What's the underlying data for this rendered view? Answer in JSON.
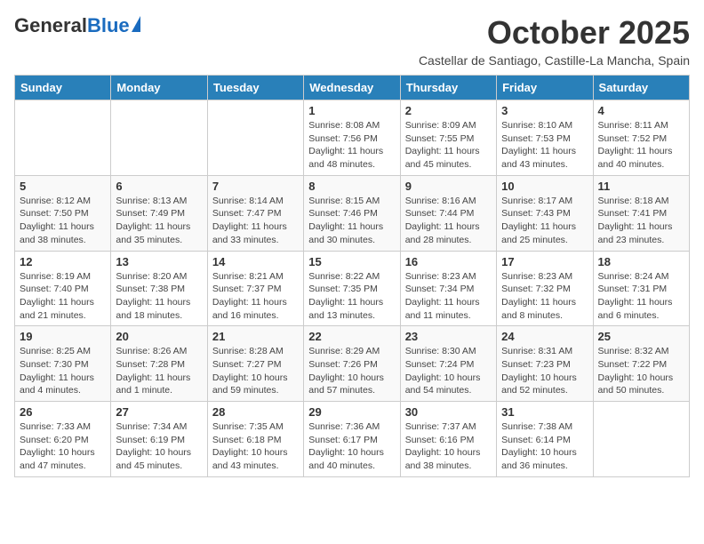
{
  "header": {
    "logo_general": "General",
    "logo_blue": "Blue",
    "month_title": "October 2025",
    "subtitle": "Castellar de Santiago, Castille-La Mancha, Spain"
  },
  "days_of_week": [
    "Sunday",
    "Monday",
    "Tuesday",
    "Wednesday",
    "Thursday",
    "Friday",
    "Saturday"
  ],
  "weeks": [
    [
      {
        "day": "",
        "info": ""
      },
      {
        "day": "",
        "info": ""
      },
      {
        "day": "",
        "info": ""
      },
      {
        "day": "1",
        "info": "Sunrise: 8:08 AM\nSunset: 7:56 PM\nDaylight: 11 hours and 48 minutes."
      },
      {
        "day": "2",
        "info": "Sunrise: 8:09 AM\nSunset: 7:55 PM\nDaylight: 11 hours and 45 minutes."
      },
      {
        "day": "3",
        "info": "Sunrise: 8:10 AM\nSunset: 7:53 PM\nDaylight: 11 hours and 43 minutes."
      },
      {
        "day": "4",
        "info": "Sunrise: 8:11 AM\nSunset: 7:52 PM\nDaylight: 11 hours and 40 minutes."
      }
    ],
    [
      {
        "day": "5",
        "info": "Sunrise: 8:12 AM\nSunset: 7:50 PM\nDaylight: 11 hours and 38 minutes."
      },
      {
        "day": "6",
        "info": "Sunrise: 8:13 AM\nSunset: 7:49 PM\nDaylight: 11 hours and 35 minutes."
      },
      {
        "day": "7",
        "info": "Sunrise: 8:14 AM\nSunset: 7:47 PM\nDaylight: 11 hours and 33 minutes."
      },
      {
        "day": "8",
        "info": "Sunrise: 8:15 AM\nSunset: 7:46 PM\nDaylight: 11 hours and 30 minutes."
      },
      {
        "day": "9",
        "info": "Sunrise: 8:16 AM\nSunset: 7:44 PM\nDaylight: 11 hours and 28 minutes."
      },
      {
        "day": "10",
        "info": "Sunrise: 8:17 AM\nSunset: 7:43 PM\nDaylight: 11 hours and 25 minutes."
      },
      {
        "day": "11",
        "info": "Sunrise: 8:18 AM\nSunset: 7:41 PM\nDaylight: 11 hours and 23 minutes."
      }
    ],
    [
      {
        "day": "12",
        "info": "Sunrise: 8:19 AM\nSunset: 7:40 PM\nDaylight: 11 hours and 21 minutes."
      },
      {
        "day": "13",
        "info": "Sunrise: 8:20 AM\nSunset: 7:38 PM\nDaylight: 11 hours and 18 minutes."
      },
      {
        "day": "14",
        "info": "Sunrise: 8:21 AM\nSunset: 7:37 PM\nDaylight: 11 hours and 16 minutes."
      },
      {
        "day": "15",
        "info": "Sunrise: 8:22 AM\nSunset: 7:35 PM\nDaylight: 11 hours and 13 minutes."
      },
      {
        "day": "16",
        "info": "Sunrise: 8:23 AM\nSunset: 7:34 PM\nDaylight: 11 hours and 11 minutes."
      },
      {
        "day": "17",
        "info": "Sunrise: 8:23 AM\nSunset: 7:32 PM\nDaylight: 11 hours and 8 minutes."
      },
      {
        "day": "18",
        "info": "Sunrise: 8:24 AM\nSunset: 7:31 PM\nDaylight: 11 hours and 6 minutes."
      }
    ],
    [
      {
        "day": "19",
        "info": "Sunrise: 8:25 AM\nSunset: 7:30 PM\nDaylight: 11 hours and 4 minutes."
      },
      {
        "day": "20",
        "info": "Sunrise: 8:26 AM\nSunset: 7:28 PM\nDaylight: 11 hours and 1 minute."
      },
      {
        "day": "21",
        "info": "Sunrise: 8:28 AM\nSunset: 7:27 PM\nDaylight: 10 hours and 59 minutes."
      },
      {
        "day": "22",
        "info": "Sunrise: 8:29 AM\nSunset: 7:26 PM\nDaylight: 10 hours and 57 minutes."
      },
      {
        "day": "23",
        "info": "Sunrise: 8:30 AM\nSunset: 7:24 PM\nDaylight: 10 hours and 54 minutes."
      },
      {
        "day": "24",
        "info": "Sunrise: 8:31 AM\nSunset: 7:23 PM\nDaylight: 10 hours and 52 minutes."
      },
      {
        "day": "25",
        "info": "Sunrise: 8:32 AM\nSunset: 7:22 PM\nDaylight: 10 hours and 50 minutes."
      }
    ],
    [
      {
        "day": "26",
        "info": "Sunrise: 7:33 AM\nSunset: 6:20 PM\nDaylight: 10 hours and 47 minutes."
      },
      {
        "day": "27",
        "info": "Sunrise: 7:34 AM\nSunset: 6:19 PM\nDaylight: 10 hours and 45 minutes."
      },
      {
        "day": "28",
        "info": "Sunrise: 7:35 AM\nSunset: 6:18 PM\nDaylight: 10 hours and 43 minutes."
      },
      {
        "day": "29",
        "info": "Sunrise: 7:36 AM\nSunset: 6:17 PM\nDaylight: 10 hours and 40 minutes."
      },
      {
        "day": "30",
        "info": "Sunrise: 7:37 AM\nSunset: 6:16 PM\nDaylight: 10 hours and 38 minutes."
      },
      {
        "day": "31",
        "info": "Sunrise: 7:38 AM\nSunset: 6:14 PM\nDaylight: 10 hours and 36 minutes."
      },
      {
        "day": "",
        "info": ""
      }
    ]
  ]
}
